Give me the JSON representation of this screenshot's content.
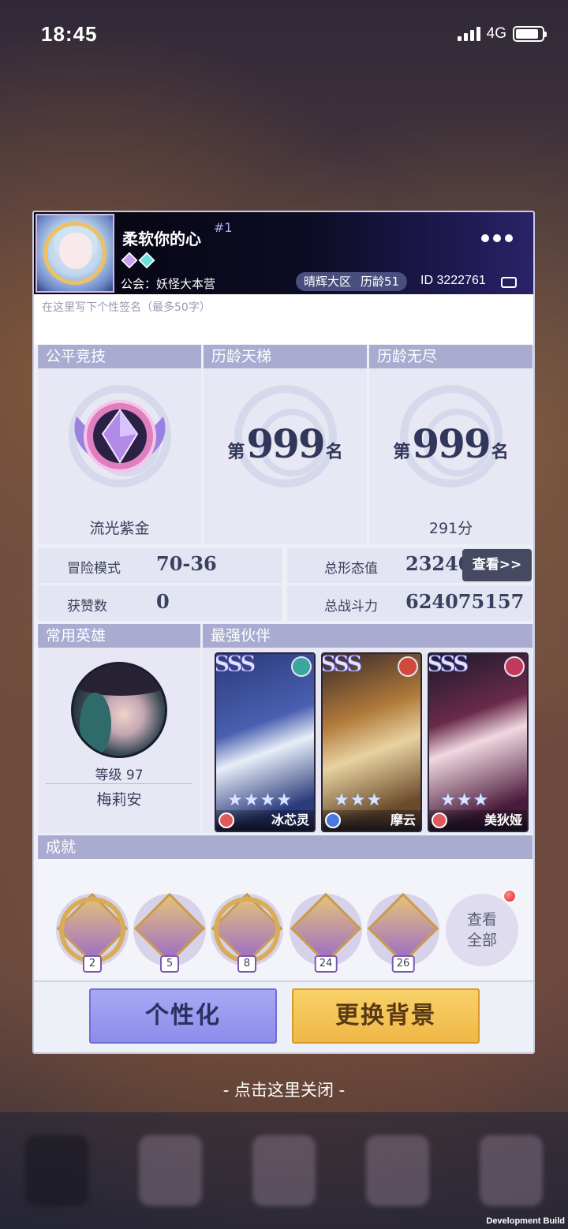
{
  "status_bar": {
    "time": "18:45",
    "network": "4G"
  },
  "profile": {
    "name": "柔软你的心",
    "rank_sup": "#1",
    "guild": "公会：妖怪大本营",
    "region": "晴辉大区",
    "age": "历龄51",
    "id": "ID 3222761",
    "signature_placeholder": "在这里写下个性签名（最多50字）"
  },
  "ranks": [
    {
      "header": "公平竞技",
      "caption": "流光紫金",
      "badge_icon": "purple-gold-rank-badge"
    },
    {
      "header": "历龄天梯",
      "prefix": "第",
      "rank": "999",
      "suffix": "名",
      "caption": ""
    },
    {
      "header": "历龄无尽",
      "prefix": "第",
      "rank": "999",
      "suffix": "名",
      "caption": "291分"
    }
  ],
  "stats": {
    "adventure_label": "冒险模式",
    "adventure_value": "70-36",
    "likes_label": "获赞数",
    "likes_value": "0",
    "forms_label": "总形态值",
    "forms_value": "23240",
    "power_label": "总战斗力",
    "power_value": "624075157",
    "view_button": "查看>>"
  },
  "common_hero": {
    "header": "常用英雄",
    "level": "等级 97",
    "name": "梅莉安"
  },
  "partners": {
    "header": "最强伙伴",
    "items": [
      {
        "grade": "SSS",
        "name": "冰芯灵",
        "stars": 4,
        "element_color": "#3aa6a0",
        "class_color": "#e05a5a"
      },
      {
        "grade": "SSS",
        "name": "摩云",
        "stars": 3,
        "element_color": "#d04a3a",
        "class_color": "#4a78e0"
      },
      {
        "grade": "SSS",
        "name": "美狄娅",
        "stars": 3,
        "element_color": "#c03a5a",
        "class_color": "#e05a5a"
      }
    ]
  },
  "achievements": {
    "header": "成就",
    "medals": [
      {
        "count": "2"
      },
      {
        "count": "5"
      },
      {
        "count": "8"
      },
      {
        "count": "24"
      },
      {
        "count": "26"
      }
    ],
    "view_all": "查看全部",
    "view_all_line1": "查看",
    "view_all_line2": "全部"
  },
  "buttons": {
    "personalize": "个性化",
    "change_background": "更换背景"
  },
  "close_hint": "- 点击这里关闭 -",
  "dev_build": "Development Build"
}
